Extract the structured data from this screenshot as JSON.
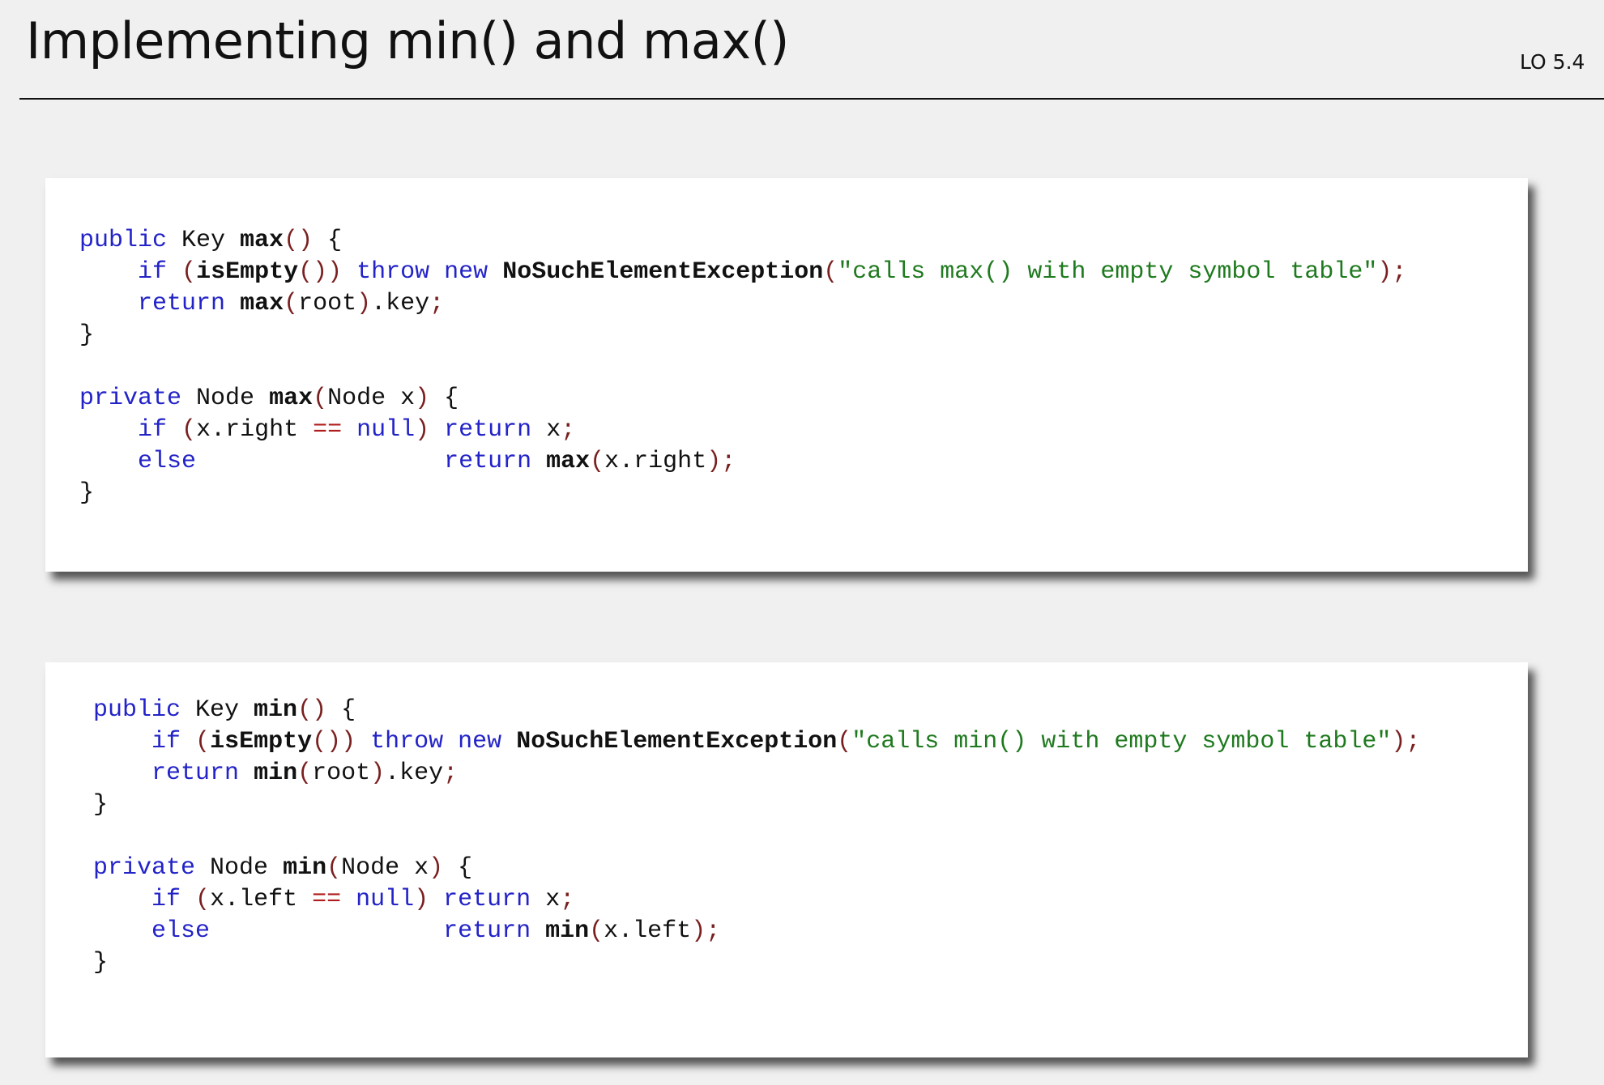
{
  "header": {
    "title": "Implementing min() and max()",
    "lo": "LO 5.4"
  },
  "code_blocks": [
    {
      "name": "max-code",
      "lines": [
        [
          [
            "kw",
            "public"
          ],
          [
            "id",
            " Key "
          ],
          [
            "fn",
            "max"
          ],
          [
            "p",
            "()"
          ],
          [
            "id",
            " {"
          ]
        ],
        [
          [
            "id",
            "    "
          ],
          [
            "kw",
            "if"
          ],
          [
            "id",
            " "
          ],
          [
            "p",
            "("
          ],
          [
            "fn",
            "isEmpty"
          ],
          [
            "p",
            "())"
          ],
          [
            "id",
            " "
          ],
          [
            "kw",
            "throw"
          ],
          [
            "id",
            " "
          ],
          [
            "kw",
            "new"
          ],
          [
            "id",
            " "
          ],
          [
            "fn",
            "NoSuchElementException"
          ],
          [
            "p",
            "("
          ],
          [
            "str",
            "\"calls max() with empty symbol table\""
          ],
          [
            "p",
            ");"
          ]
        ],
        [
          [
            "id",
            "    "
          ],
          [
            "kw",
            "return"
          ],
          [
            "id",
            " "
          ],
          [
            "fn",
            "max"
          ],
          [
            "p",
            "("
          ],
          [
            "id",
            "root"
          ],
          [
            "p",
            ")"
          ],
          [
            "id",
            ".key"
          ],
          [
            "p",
            ";"
          ]
        ],
        [
          [
            "id",
            "}"
          ]
        ],
        [
          [
            "id",
            ""
          ]
        ],
        [
          [
            "kw",
            "private"
          ],
          [
            "id",
            " Node "
          ],
          [
            "fn",
            "max"
          ],
          [
            "p",
            "("
          ],
          [
            "id",
            "Node x"
          ],
          [
            "p",
            ")"
          ],
          [
            "id",
            " {"
          ]
        ],
        [
          [
            "id",
            "    "
          ],
          [
            "kw",
            "if"
          ],
          [
            "id",
            " "
          ],
          [
            "p",
            "("
          ],
          [
            "id",
            "x.right "
          ],
          [
            "op",
            "=="
          ],
          [
            "id",
            " "
          ],
          [
            "kw",
            "null"
          ],
          [
            "p",
            ")"
          ],
          [
            "id",
            " "
          ],
          [
            "kw",
            "return"
          ],
          [
            "id",
            " x"
          ],
          [
            "p",
            ";"
          ]
        ],
        [
          [
            "id",
            "    "
          ],
          [
            "kw",
            "else"
          ],
          [
            "id",
            "                 "
          ],
          [
            "kw",
            "return"
          ],
          [
            "id",
            " "
          ],
          [
            "fn",
            "max"
          ],
          [
            "p",
            "("
          ],
          [
            "id",
            "x.right"
          ],
          [
            "p",
            ");"
          ]
        ],
        [
          [
            "id",
            "}"
          ]
        ]
      ]
    },
    {
      "name": "min-code",
      "lines": [
        [
          [
            "kw",
            "public"
          ],
          [
            "id",
            " Key "
          ],
          [
            "fn",
            "min"
          ],
          [
            "p",
            "()"
          ],
          [
            "id",
            " {"
          ]
        ],
        [
          [
            "id",
            "    "
          ],
          [
            "kw",
            "if"
          ],
          [
            "id",
            " "
          ],
          [
            "p",
            "("
          ],
          [
            "fn",
            "isEmpty"
          ],
          [
            "p",
            "())"
          ],
          [
            "id",
            " "
          ],
          [
            "kw",
            "throw"
          ],
          [
            "id",
            " "
          ],
          [
            "kw",
            "new"
          ],
          [
            "id",
            " "
          ],
          [
            "fn",
            "NoSuchElementException"
          ],
          [
            "p",
            "("
          ],
          [
            "str",
            "\"calls min() with empty symbol table\""
          ],
          [
            "p",
            ");"
          ]
        ],
        [
          [
            "id",
            "    "
          ],
          [
            "kw",
            "return"
          ],
          [
            "id",
            " "
          ],
          [
            "fn",
            "min"
          ],
          [
            "p",
            "("
          ],
          [
            "id",
            "root"
          ],
          [
            "p",
            ")"
          ],
          [
            "id",
            ".key"
          ],
          [
            "p",
            ";"
          ]
        ],
        [
          [
            "id",
            "}"
          ]
        ],
        [
          [
            "id",
            ""
          ]
        ],
        [
          [
            "kw",
            "private"
          ],
          [
            "id",
            " Node "
          ],
          [
            "fn",
            "min"
          ],
          [
            "p",
            "("
          ],
          [
            "id",
            "Node x"
          ],
          [
            "p",
            ")"
          ],
          [
            "id",
            " {"
          ]
        ],
        [
          [
            "id",
            "    "
          ],
          [
            "kw",
            "if"
          ],
          [
            "id",
            " "
          ],
          [
            "p",
            "("
          ],
          [
            "id",
            "x.left "
          ],
          [
            "op",
            "=="
          ],
          [
            "id",
            " "
          ],
          [
            "kw",
            "null"
          ],
          [
            "p",
            ")"
          ],
          [
            "id",
            " "
          ],
          [
            "kw",
            "return"
          ],
          [
            "id",
            " x"
          ],
          [
            "p",
            ";"
          ]
        ],
        [
          [
            "id",
            "    "
          ],
          [
            "kw",
            "else"
          ],
          [
            "id",
            "                "
          ],
          [
            "kw",
            "return"
          ],
          [
            "id",
            " "
          ],
          [
            "fn",
            "min"
          ],
          [
            "p",
            "("
          ],
          [
            "id",
            "x.left"
          ],
          [
            "p",
            ");"
          ]
        ],
        [
          [
            "id",
            "}"
          ]
        ]
      ]
    }
  ]
}
